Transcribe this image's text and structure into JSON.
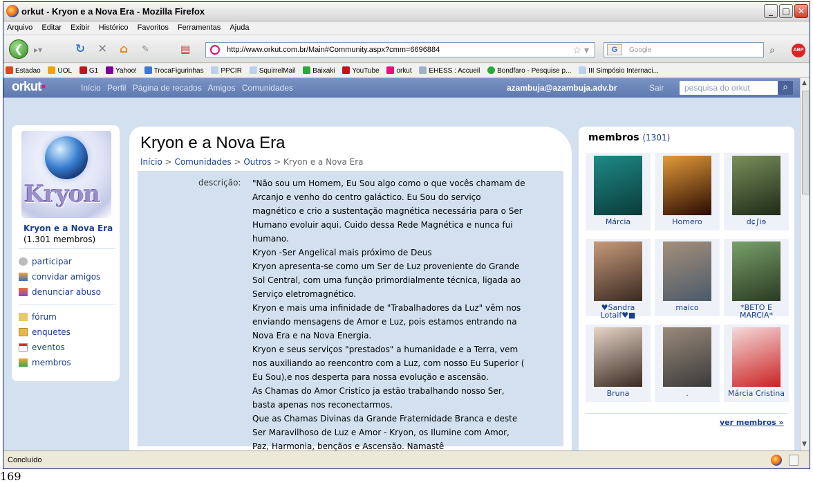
{
  "window": {
    "title": "orkut - Kryon e a Nova Era - Mozilla Firefox"
  },
  "menu": [
    "Arquivo",
    "Editar",
    "Exibir",
    "Histórico",
    "Favoritos",
    "Ferramentas",
    "Ajuda"
  ],
  "navbar": {
    "url": "http://www.orkut.com.br/Main#Community.aspx?cmm=6696884",
    "search_placeholder": "Google",
    "search_engine_icon": "G"
  },
  "bookmarks": [
    {
      "label": "Estadao",
      "color": "#d84a1b"
    },
    {
      "label": "UOL",
      "color": "#f0a400"
    },
    {
      "label": "G1",
      "color": "#c4141b"
    },
    {
      "label": "Yahoo!",
      "color": "#7b0099"
    },
    {
      "label": "TrocaFigurinhas",
      "color": "#3a7bd5"
    },
    {
      "label": "PPCIR",
      "color": "#bcd0ee"
    },
    {
      "label": "SquirrelMail",
      "color": "#bcd0ee"
    },
    {
      "label": "Baixaki",
      "color": "#2aa83a"
    },
    {
      "label": "YouTube",
      "color": "#c4141b"
    },
    {
      "label": "orkut",
      "color": "#e8117f"
    },
    {
      "label": "EHESS : Accueil",
      "color": "#9fb0c8"
    },
    {
      "label": "Bondfaro - Pesquise p...",
      "color": "#2aa83a"
    },
    {
      "label": "III Simpósio Internaci...",
      "color": "#bcd0ee"
    }
  ],
  "orkut": {
    "logo": "orkut",
    "nav": [
      "Início",
      "Perfil",
      "Página de recados",
      "Amigos",
      "Comunidades"
    ],
    "user": "azambuja@azambuja.adv.br",
    "logout": "Sair",
    "search_placeholder": "pesquisa do orkut",
    "brand_color": "#e8117f",
    "header_color": "#6d84b4"
  },
  "community": {
    "logo_text": "Kryon",
    "name": "Kryon e a Nova Era",
    "members_count": "(1.301 membros)",
    "actions": [
      "participar",
      "convidar amigos",
      "denunciar abuso"
    ],
    "sections": [
      "fórum",
      "enquetes",
      "eventos",
      "membros"
    ]
  },
  "main": {
    "title": "Kryon e a Nova Era",
    "breadcrumb": {
      "home": "Início",
      "sep": " > ",
      "communities": "Comunidades",
      "category": "Outros",
      "current": "Kryon e a Nova Era"
    },
    "description_label": "descrição:",
    "description_lines": [
      "\"Não sou um Homem, Eu Sou algo como o que vocês chamam de",
      "Arcanjo e venho do centro galáctico. Eu Sou do serviço",
      "magnético e crio a sustentação magnética necessária para o Ser",
      "Humano evoluir aqui. Cuido dessa Rede Magnética e nunca fui",
      "humano.",
      "Kryon -Ser Angelical mais próximo de Deus",
      "Kryon apresenta-se como um Ser de Luz proveniente do Grande",
      "Sol Central, com uma função primordialmente técnica, ligada ao",
      "Serviço eletromagnético.",
      "Kryon e mais uma infinidade de \"Trabalhadores da Luz\" vêm nos",
      "enviando mensagens de Amor e Luz, pois estamos entrando na",
      "Nova Era e na Nova Energia.",
      "Kryon e seus serviços \"prestados\" a humanidade e a Terra, vem",
      "nos auxiliando ao reencontro com a Luz, com nosso Eu Superior (",
      "Eu Sou),e nos desperta para nossa evolução e ascensão.",
      "As Chamas do Amor Cristíco ja estão trabalhando nosso Ser,",
      "basta apenas nos reconectarmos.",
      "Que as Chamas Divinas da Grande Fraternidade Branca e deste",
      "Ser Maravilhoso de Luz e Amor - Kryon, os Ilumine com Amor,",
      "Paz, Harmonia, bençãos e Ascensão. Namastê"
    ]
  },
  "members": {
    "title": "membros",
    "count": "(1301)",
    "list": [
      {
        "name": "Márcia",
        "colors": [
          "#1e8a86",
          "#0a3b3a"
        ]
      },
      {
        "name": "Homero",
        "colors": [
          "#e29a3a",
          "#2a0a02"
        ]
      },
      {
        "name": "dɕ∫iɘ",
        "colors": [
          "#7a8f5a",
          "#1e2a18"
        ]
      },
      {
        "name": "♥Sandra Lotaif♥■",
        "colors": [
          "#c79a7a",
          "#3a2a22"
        ]
      },
      {
        "name": "maico",
        "colors": [
          "#a58f7a",
          "#4a5a6a"
        ]
      },
      {
        "name": "*BETO E MARCIA*",
        "colors": [
          "#7aa06a",
          "#2a3a22"
        ]
      },
      {
        "name": "Bruna",
        "colors": [
          "#e6d4c6",
          "#3a2a22"
        ]
      },
      {
        "name": ".",
        "colors": [
          "#9a8a7a",
          "#3a3a3a"
        ]
      },
      {
        "name": "Márcia Cristina",
        "colors": [
          "#f4dada",
          "#cc2222"
        ]
      }
    ],
    "see_all": "ver membros »"
  },
  "status": {
    "text": "Concluído"
  },
  "page_number": "169"
}
